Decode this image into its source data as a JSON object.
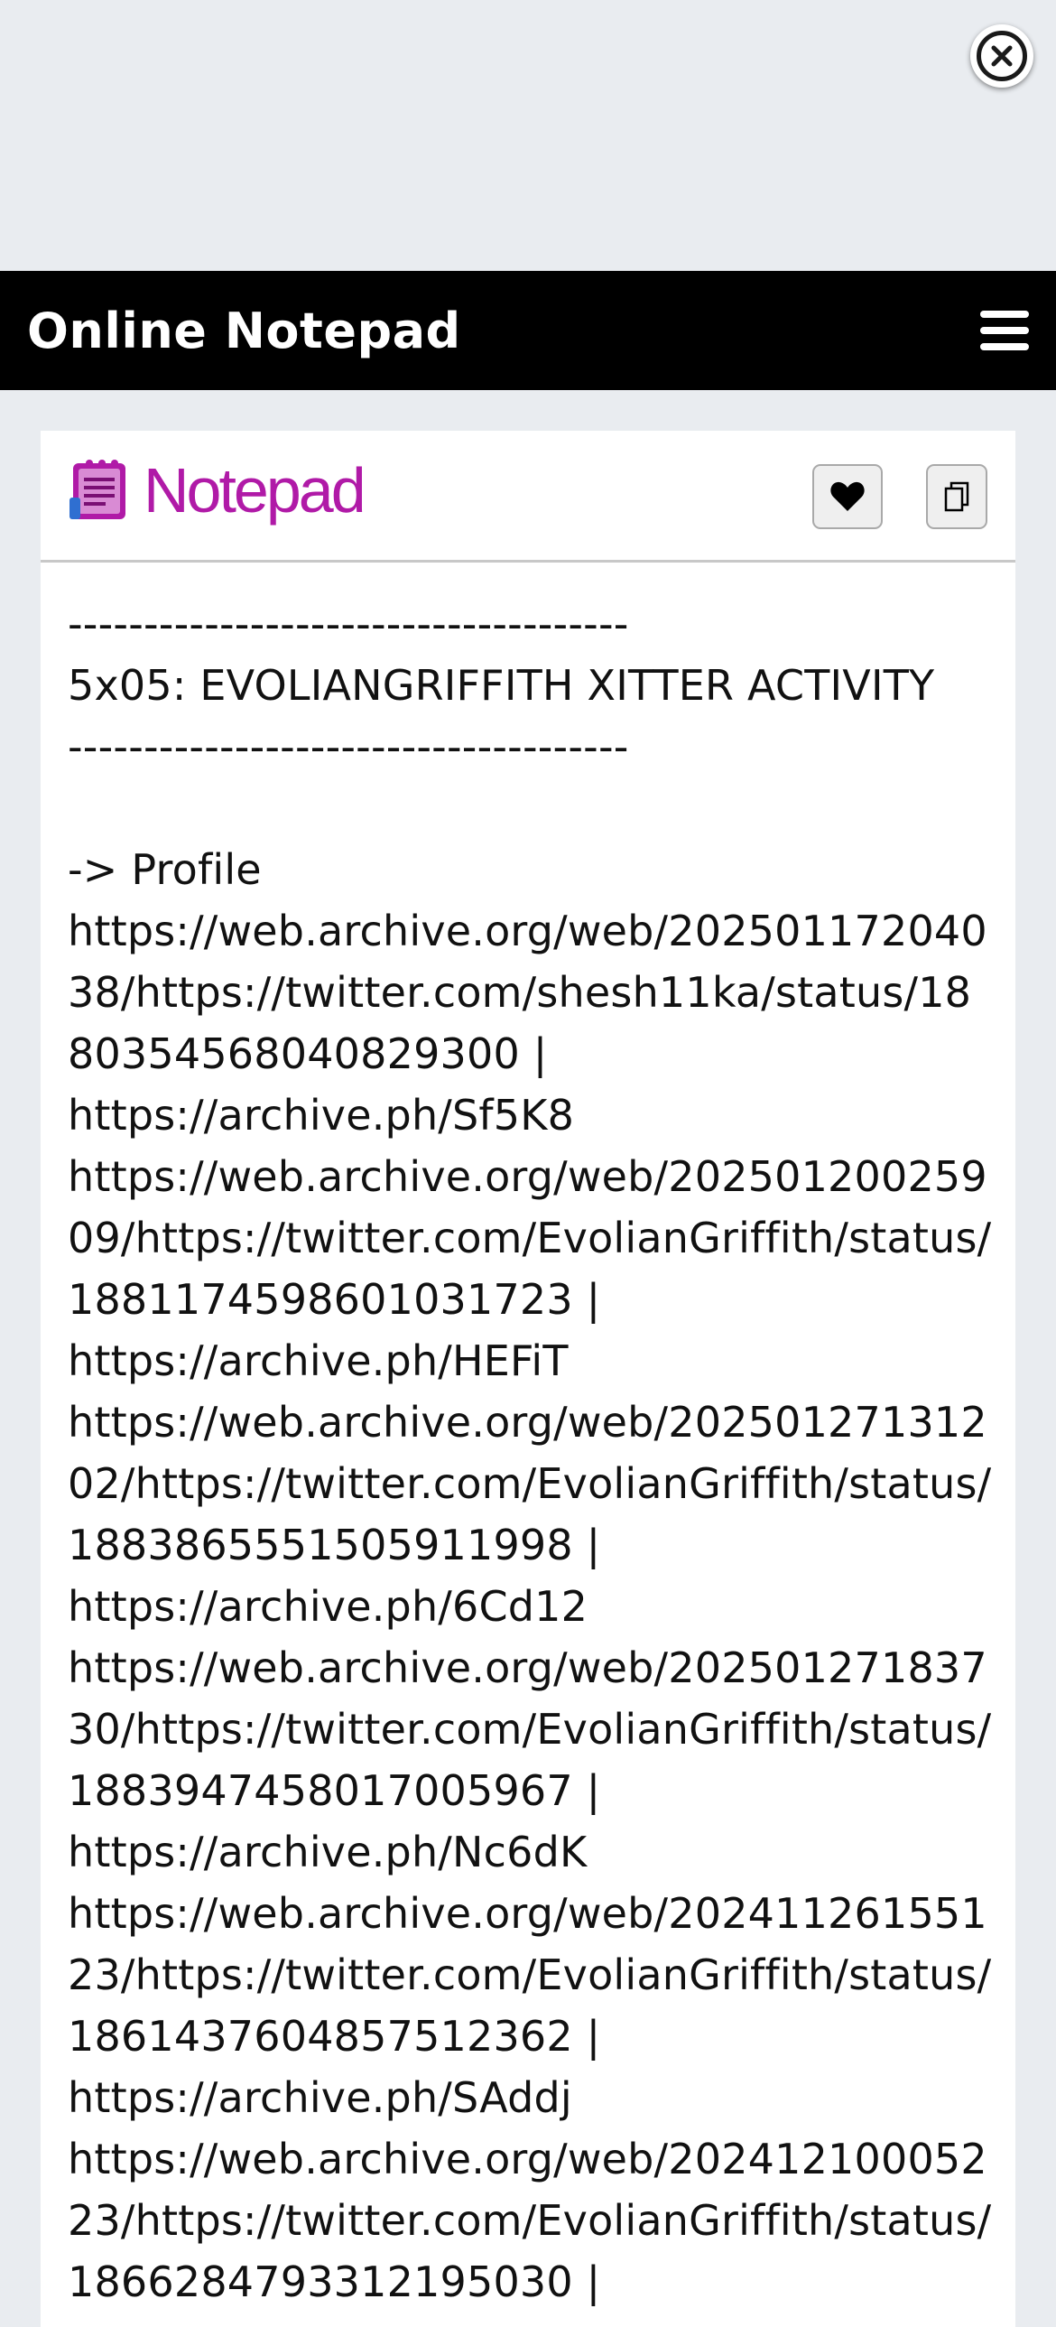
{
  "ad": {
    "close_icon": "close-icon"
  },
  "topbar": {
    "title": "Online Notepad",
    "menu_icon": "hamburger-menu-icon"
  },
  "card": {
    "logo_text": "Notepad",
    "logo_icon": "notepad-logo-icon",
    "favorite_icon": "heart-icon",
    "copy_icon": "copy-icon"
  },
  "note": {
    "content": "-------------------------------------\n5x05: EVOLIANGRIFFITH XITTER ACTIVITY\n-------------------------------------\n\n-> Profile\nhttps://web.archive.org/web/20250117204038/https://twitter.com/shesh11ka/status/1880354568040829300 |\nhttps://archive.ph/Sf5K8\nhttps://web.archive.org/web/20250120025909/https://twitter.com/EvolianGriffith/status/1881174598601031723 |\nhttps://archive.ph/HEFiT\nhttps://web.archive.org/web/20250127131202/https://twitter.com/EvolianGriffith/status/1883865551505911998 |\nhttps://archive.ph/6Cd12\nhttps://web.archive.org/web/20250127183730/https://twitter.com/EvolianGriffith/status/1883947458017005967 |\nhttps://archive.ph/Nc6dK\nhttps://web.archive.org/web/20241126155123/https://twitter.com/EvolianGriffith/status/1861437604857512362 |\nhttps://archive.ph/SAddj\nhttps://web.archive.org/web/20241210005223/https://twitter.com/EvolianGriffith/status/1866284793312195030 |"
  }
}
